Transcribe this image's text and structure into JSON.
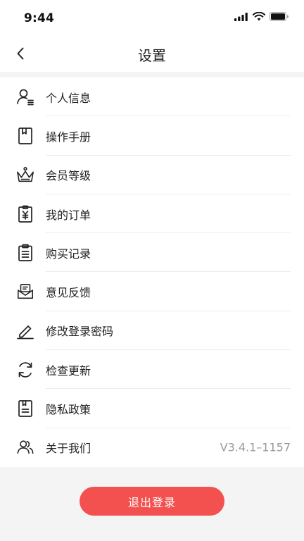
{
  "status_bar": {
    "time": "9:44",
    "icons": [
      "signal-icon",
      "wifi-icon",
      "battery-icon"
    ]
  },
  "nav": {
    "back_icon": "chevron-left-icon",
    "title": "设置"
  },
  "settings": {
    "items": [
      {
        "label": "个人信息",
        "icon": "user-profile-icon"
      },
      {
        "label": "操作手册",
        "icon": "manual-book-icon"
      },
      {
        "label": "会员等级",
        "icon": "crown-icon"
      },
      {
        "label": "我的订单",
        "icon": "order-receipt-icon"
      },
      {
        "label": "购买记录",
        "icon": "purchase-clipboard-icon"
      },
      {
        "label": "意见反馈",
        "icon": "feedback-mail-icon"
      },
      {
        "label": "修改登录密码",
        "icon": "edit-pencil-icon"
      },
      {
        "label": "检查更新",
        "icon": "refresh-icon"
      },
      {
        "label": "隐私政策",
        "icon": "privacy-document-icon"
      },
      {
        "label": "关于我们",
        "icon": "team-users-icon",
        "value": "V3.4.1–1157"
      }
    ]
  },
  "footer": {
    "logout_label": "退出登录"
  },
  "colors": {
    "accent": "#f35150",
    "background": "#f4f4f5",
    "divider": "#ececec",
    "secondary_text": "#9a9a9a"
  }
}
